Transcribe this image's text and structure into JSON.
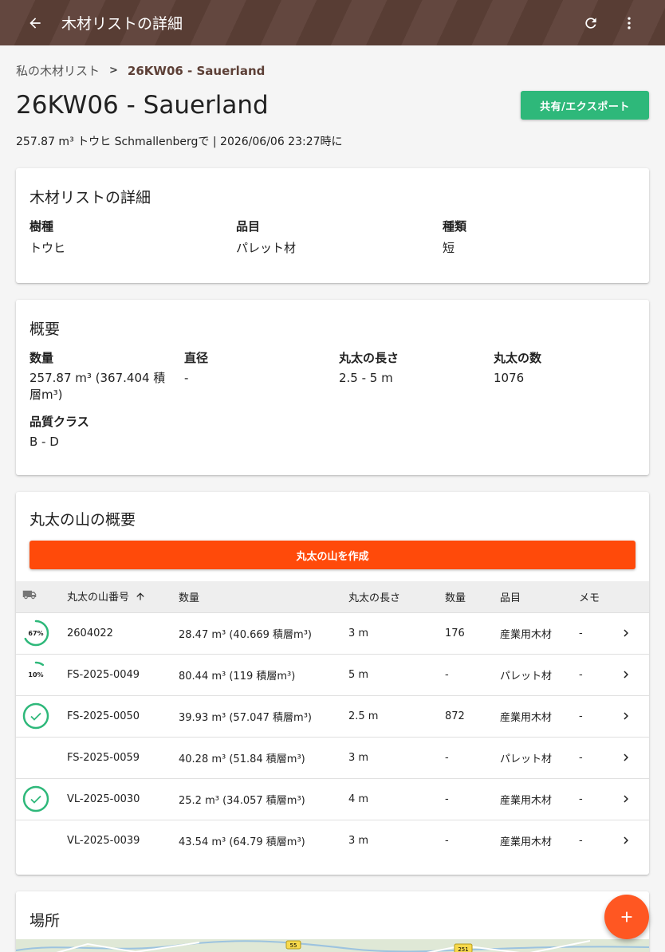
{
  "appbar": {
    "title": "木材リストの詳細"
  },
  "breadcrumb": {
    "root": "私の木材リスト",
    "separator": ">",
    "current": "26KW06 - Sauerland"
  },
  "header": {
    "title": "26KW06 - Sauerland",
    "subtitle": "257.87 m³ トウヒ Schmallenbergで | 2026/06/06 23:27時に",
    "share_label": "共有/エクスポート"
  },
  "details": {
    "title": "木材リストの詳細",
    "species_label": "樹種",
    "species_value": "トウヒ",
    "product_label": "品目",
    "product_value": "パレット材",
    "type_label": "種類",
    "type_value": "短"
  },
  "summary": {
    "title": "概要",
    "amount_label": "数量",
    "amount_value": "257.87 m³ (367.404 積層m³)",
    "diameter_label": "直径",
    "diameter_value": "-",
    "length_label": "丸太の長さ",
    "length_value": "2.5 - 5 m",
    "count_label": "丸太の数",
    "count_value": "1076",
    "quality_label": "品質クラス",
    "quality_value": "B - D"
  },
  "piles": {
    "title": "丸太の山の概要",
    "create_label": "丸太の山を作成",
    "columns": {
      "number": "丸太の山番号",
      "amount": "数量",
      "length": "丸太の長さ",
      "count": "数量",
      "product": "品目",
      "memo": "メモ"
    },
    "rows": [
      {
        "status": "progress",
        "progress": 0.67,
        "progress_label": "67%",
        "number": "2604022",
        "amount": "28.47 m³ (40.669 積層m³)",
        "length": "3 m",
        "count": "176",
        "product": "産業用木材",
        "memo": "-"
      },
      {
        "status": "progress",
        "progress": 0.1,
        "progress_label": "10%",
        "number": "FS-2025-0049",
        "amount": "80.44 m³ (119 積層m³)",
        "length": "5 m",
        "count": "-",
        "product": "パレット材",
        "memo": "-"
      },
      {
        "status": "done",
        "progress": 1,
        "progress_label": "",
        "number": "FS-2025-0050",
        "amount": "39.93 m³ (57.047 積層m³)",
        "length": "2.5 m",
        "count": "872",
        "product": "産業用木材",
        "memo": "-"
      },
      {
        "status": "none",
        "progress": 0,
        "progress_label": "",
        "number": "FS-2025-0059",
        "amount": "40.28 m³ (51.84 積層m³)",
        "length": "3 m",
        "count": "-",
        "product": "パレット材",
        "memo": "-"
      },
      {
        "status": "done",
        "progress": 1,
        "progress_label": "",
        "number": "VL-2025-0030",
        "amount": "25.2 m³ (34.057 積層m³)",
        "length": "4 m",
        "count": "-",
        "product": "産業用木材",
        "memo": "-"
      },
      {
        "status": "none",
        "progress": 0,
        "progress_label": "",
        "number": "VL-2025-0039",
        "amount": "43.54 m³ (64.79 積層m³)",
        "length": "3 m",
        "count": "-",
        "product": "産業用木材",
        "memo": "-"
      }
    ]
  },
  "location": {
    "title": "場所",
    "map_labels": [
      "55",
      "251"
    ]
  },
  "colors": {
    "appbar": "#5d4037",
    "share": "#2eb87a",
    "create": "#ff4a0a",
    "fab": "#ff5722",
    "done": "#2eb87a"
  },
  "icons": [
    "back-arrow-icon",
    "refresh-icon",
    "more-vert-icon",
    "truck-icon",
    "sort-up-icon",
    "chevron-right-icon",
    "check-icon",
    "plus-icon"
  ]
}
